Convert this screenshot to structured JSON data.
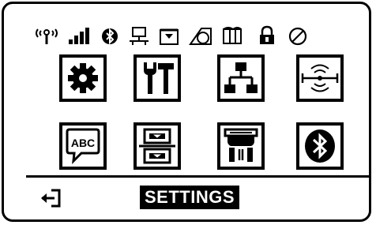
{
  "status_icons": [
    "antenna-icon",
    "signal-strength-icon",
    "bluetooth-status-icon",
    "network-status-icon",
    "data-icon",
    "ribbon-icon",
    "media-icon",
    "lock-icon",
    "error-icon"
  ],
  "menu_items": [
    {
      "id": "settings",
      "icon": "gear-icon"
    },
    {
      "id": "tools",
      "icon": "tools-icon"
    },
    {
      "id": "network",
      "icon": "network-icon"
    },
    {
      "id": "rfid",
      "icon": "rfid-icon"
    },
    {
      "id": "language",
      "icon": "abc-speech-icon"
    },
    {
      "id": "sensors",
      "icon": "sensor-icon"
    },
    {
      "id": "ports",
      "icon": "ports-icon"
    },
    {
      "id": "bluetooth",
      "icon": "bluetooth-icon"
    }
  ],
  "footer": {
    "back_icon": "exit-arrow-icon",
    "title": "SETTINGS"
  },
  "colors": {
    "foreground": "#000000",
    "background": "#ffffff"
  }
}
